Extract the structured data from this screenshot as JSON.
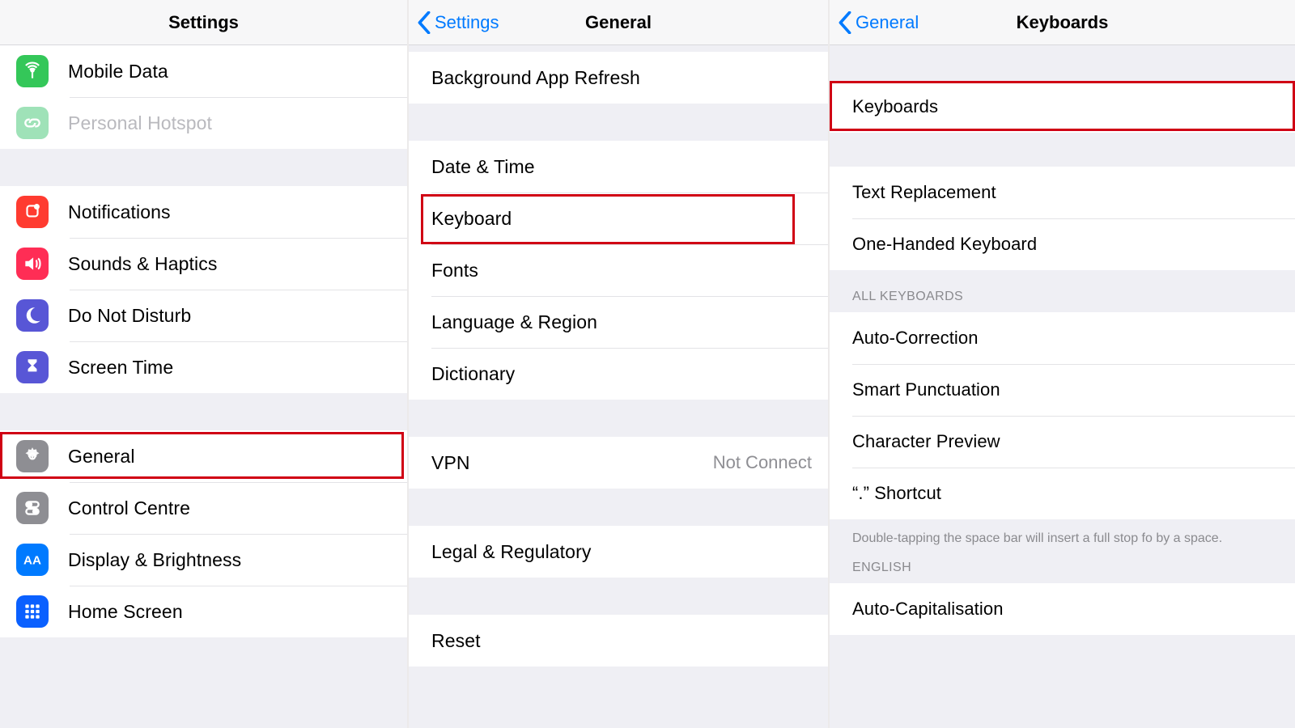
{
  "col1": {
    "title": "Settings",
    "group1": [
      {
        "icon": "antenna",
        "bg": "bg-green",
        "label": "Mobile Data"
      },
      {
        "icon": "link",
        "bg": "bg-greenlt",
        "label": "Personal Hotspot",
        "dim": true
      }
    ],
    "group2": [
      {
        "icon": "bell",
        "bg": "bg-red",
        "label": "Notifications"
      },
      {
        "icon": "speaker",
        "bg": "bg-pink",
        "label": "Sounds & Haptics"
      },
      {
        "icon": "moon",
        "bg": "bg-purple",
        "label": "Do Not Disturb"
      },
      {
        "icon": "hourglass",
        "bg": "bg-spurple",
        "label": "Screen Time"
      }
    ],
    "group3": [
      {
        "icon": "gear",
        "bg": "bg-gray",
        "label": "General"
      },
      {
        "icon": "toggles",
        "bg": "bg-gray",
        "label": "Control Centre"
      },
      {
        "icon": "aa",
        "bg": "bg-blue",
        "label": "Display & Brightness"
      },
      {
        "icon": "grid",
        "bg": "bg-bluelg",
        "label": "Home Screen"
      }
    ]
  },
  "col2": {
    "back": "Settings",
    "title": "General",
    "groupA": [
      {
        "label": "Background App Refresh"
      }
    ],
    "groupB": [
      {
        "label": "Date & Time"
      },
      {
        "label": "Keyboard"
      },
      {
        "label": "Fonts"
      },
      {
        "label": "Language & Region"
      },
      {
        "label": "Dictionary"
      }
    ],
    "groupC": [
      {
        "label": "VPN",
        "detail": "Not Connect"
      }
    ],
    "groupD": [
      {
        "label": "Legal & Regulatory"
      }
    ],
    "groupE": [
      {
        "label": "Reset"
      }
    ]
  },
  "col3": {
    "back": "General",
    "title": "Keyboards",
    "groupA": [
      {
        "label": "Keyboards"
      }
    ],
    "groupB": [
      {
        "label": "Text Replacement"
      },
      {
        "label": "One-Handed Keyboard"
      }
    ],
    "header_allkbd": "ALL KEYBOARDS",
    "groupC": [
      {
        "label": "Auto-Correction"
      },
      {
        "label": "Smart Punctuation"
      },
      {
        "label": "Character Preview"
      },
      {
        "label": "“.” Shortcut"
      }
    ],
    "footer_shortcut": "Double-tapping the space bar will insert a full stop fo by a space.",
    "header_english": "ENGLISH",
    "groupD": [
      {
        "label": "Auto-Capitalisation"
      }
    ]
  }
}
